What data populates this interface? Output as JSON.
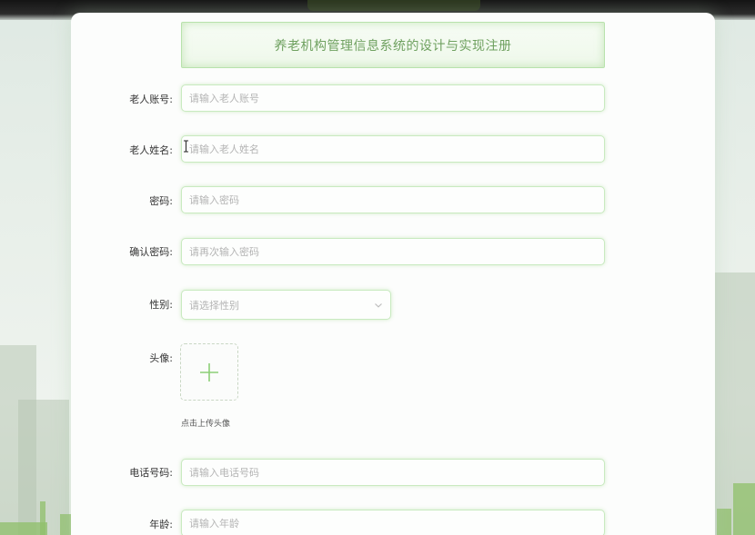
{
  "form": {
    "title": "养老机构管理信息系统的设计与实现注册",
    "account": {
      "label": "老人账号:",
      "placeholder": "请输入老人账号"
    },
    "name": {
      "label": "老人姓名:",
      "placeholder": "请输入老人姓名"
    },
    "password": {
      "label": "密码:",
      "placeholder": "请输入密码"
    },
    "confirm_password": {
      "label": "确认密码:",
      "placeholder": "请再次输入密码"
    },
    "gender": {
      "label": "性别:",
      "placeholder": "请选择性别"
    },
    "avatar": {
      "label": "头像:",
      "hint": "点击上传头像"
    },
    "phone": {
      "label": "电话号码:",
      "placeholder": "请输入电话号码"
    },
    "age": {
      "label": "年龄:",
      "placeholder": "请输入年龄"
    }
  },
  "icons": {
    "chevron": "chevron-down-icon",
    "plus": "plus-icon",
    "cursor": "text-cursor-icon"
  },
  "colors": {
    "accent_green": "#6fa160",
    "border_green": "#c9eac0",
    "placeholder": "#b4b4b4"
  }
}
